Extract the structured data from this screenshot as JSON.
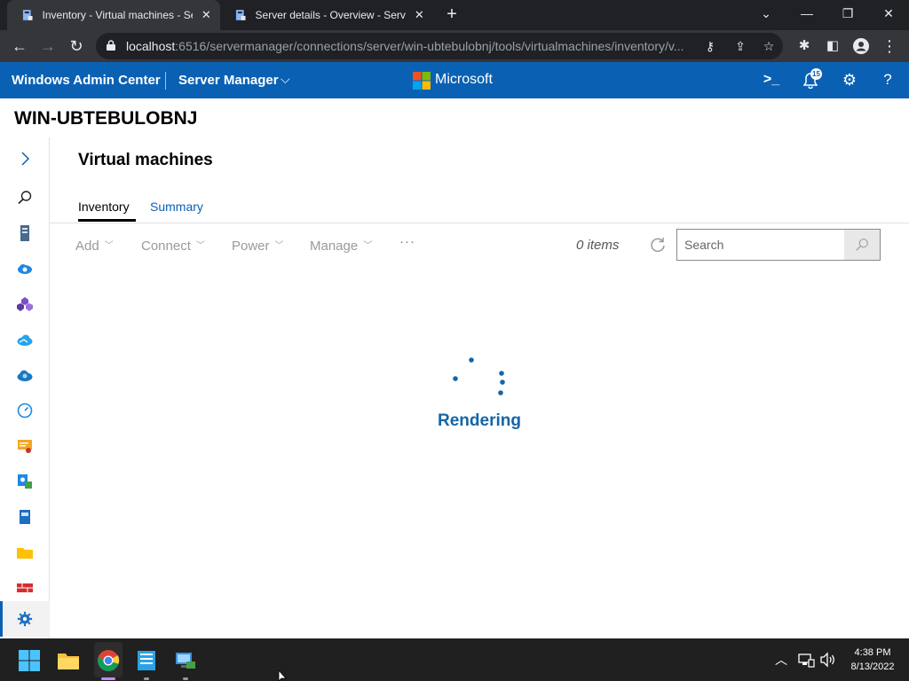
{
  "browser": {
    "tabs": [
      {
        "title": "Inventory - Virtual machines - Se",
        "active": true
      },
      {
        "title": "Server details - Overview - Server",
        "active": false
      }
    ],
    "url_host": "localhost",
    "url_rest": ":6516/servermanager/connections/server/win-ubtebulobnj/tools/virtualmachines/inventory/v..."
  },
  "header": {
    "brand": "Windows Admin Center",
    "app": "Server Manager",
    "vendor": "Microsoft",
    "notification_count": "15"
  },
  "server": {
    "name": "WIN-UBTEBULOBNJ"
  },
  "page": {
    "title": "Virtual machines",
    "tabs": [
      {
        "label": "Inventory",
        "active": true
      },
      {
        "label": "Summary",
        "active": false
      }
    ]
  },
  "toolbar": {
    "add": "Add",
    "connect": "Connect",
    "power": "Power",
    "manage": "Manage",
    "more": "···",
    "item_count": "0 items",
    "search_placeholder": "Search"
  },
  "status": {
    "loading_text": "Rendering"
  },
  "taskbar": {
    "time": "4:38 PM",
    "date": "8/13/2022"
  },
  "colors": {
    "header_blue": "#0a61b4",
    "accent": "#0a61b4",
    "taskbar": "#202020"
  }
}
